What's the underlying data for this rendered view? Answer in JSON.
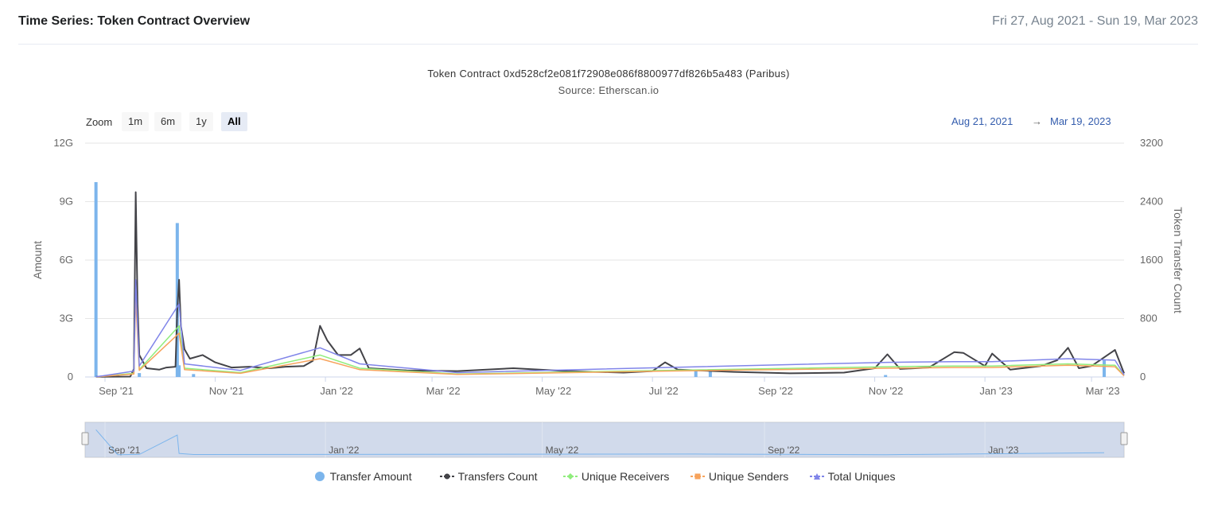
{
  "header": {
    "title": "Time Series: Token Contract Overview",
    "date_range": "Fri 27, Aug 2021 - Sun 19, Mar 2023"
  },
  "zoom": {
    "label": "Zoom",
    "buttons": [
      "1m",
      "6m",
      "1y",
      "All"
    ],
    "active": "All"
  },
  "range_selector": {
    "from": "Aug 21, 2021",
    "separator": "→",
    "to": "Mar 19, 2023"
  },
  "colors": {
    "transfer_amount": "#7cb5ec",
    "transfers_count": "#434348",
    "unique_receivers": "#90ed7d",
    "unique_senders": "#f7a35c",
    "total_uniques": "#8085e9",
    "navigator_fill": "#ccd6eb",
    "navigator_mask": "#b9c6e0"
  },
  "chart_data": {
    "type": "line",
    "title": "Token Contract 0xd528cf2e081f72908e086f8800977df826b5a483 (Paribus)",
    "subtitle": "Source: Etherscan.io",
    "xlabel": "",
    "x_ticks": [
      "Sep '21",
      "Nov '21",
      "Jan '22",
      "Mar '22",
      "May '22",
      "Jul '22",
      "Sep '22",
      "Nov '22",
      "Jan '23",
      "Mar '23"
    ],
    "navigator_ticks": [
      "Sep '21",
      "Jan '22",
      "May '22",
      "Sep '22",
      "Jan '23"
    ],
    "x_range": [
      "2021-08-21",
      "2023-03-19"
    ],
    "y_left": {
      "label": "Amount",
      "ticks": [
        "0",
        "3G",
        "6G",
        "9G",
        "12G"
      ],
      "ylim": [
        0,
        12000000000
      ]
    },
    "y_right": {
      "label": "Token Transfer Count",
      "ticks": [
        "0",
        "800",
        "1600",
        "2400",
        "3200"
      ],
      "ylim": [
        0,
        3200
      ]
    },
    "grid": true,
    "legend_position": "bottom-center",
    "series": [
      {
        "name": "Transfer Amount",
        "type": "column",
        "axis": "left",
        "points": [
          [
            "2021-08-27",
            10000000000
          ],
          [
            "2021-09-08",
            100000000
          ],
          [
            "2021-09-20",
            200000000
          ],
          [
            "2021-10-11",
            7900000000
          ],
          [
            "2021-10-12",
            600000000
          ],
          [
            "2021-10-20",
            150000000
          ],
          [
            "2022-07-25",
            350000000
          ],
          [
            "2022-08-02",
            300000000
          ],
          [
            "2022-11-07",
            100000000
          ],
          [
            "2023-03-08",
            850000000
          ]
        ]
      },
      {
        "name": "Transfers Count",
        "type": "line",
        "axis": "right",
        "points": [
          [
            "2021-08-27",
            2
          ],
          [
            "2021-09-15",
            5
          ],
          [
            "2021-09-17",
            110
          ],
          [
            "2021-09-18",
            2530
          ],
          [
            "2021-09-19",
            1000
          ],
          [
            "2021-09-20",
            300
          ],
          [
            "2021-09-24",
            120
          ],
          [
            "2021-10-01",
            100
          ],
          [
            "2021-10-05",
            130
          ],
          [
            "2021-10-10",
            140
          ],
          [
            "2021-10-11",
            900
          ],
          [
            "2021-10-12",
            1330
          ],
          [
            "2021-10-13",
            700
          ],
          [
            "2021-10-15",
            380
          ],
          [
            "2021-10-18",
            250
          ],
          [
            "2021-10-25",
            300
          ],
          [
            "2021-11-01",
            200
          ],
          [
            "2021-11-10",
            130
          ],
          [
            "2021-11-20",
            140
          ],
          [
            "2021-12-01",
            120
          ],
          [
            "2021-12-10",
            140
          ],
          [
            "2021-12-20",
            150
          ],
          [
            "2021-12-25",
            220
          ],
          [
            "2021-12-29",
            700
          ],
          [
            "2022-01-02",
            500
          ],
          [
            "2022-01-08",
            300
          ],
          [
            "2022-01-15",
            300
          ],
          [
            "2022-01-20",
            390
          ],
          [
            "2022-01-25",
            120
          ],
          [
            "2022-02-15",
            90
          ],
          [
            "2022-03-15",
            80
          ],
          [
            "2022-04-15",
            120
          ],
          [
            "2022-05-15",
            80
          ],
          [
            "2022-06-15",
            60
          ],
          [
            "2022-07-01",
            80
          ],
          [
            "2022-07-08",
            200
          ],
          [
            "2022-07-15",
            100
          ],
          [
            "2022-08-15",
            70
          ],
          [
            "2022-09-15",
            50
          ],
          [
            "2022-10-15",
            60
          ],
          [
            "2022-11-01",
            120
          ],
          [
            "2022-11-08",
            310
          ],
          [
            "2022-11-15",
            110
          ],
          [
            "2022-12-01",
            130
          ],
          [
            "2022-12-15",
            340
          ],
          [
            "2022-12-20",
            330
          ],
          [
            "2023-01-01",
            150
          ],
          [
            "2023-01-05",
            320
          ],
          [
            "2023-01-15",
            100
          ],
          [
            "2023-02-01",
            150
          ],
          [
            "2023-02-10",
            230
          ],
          [
            "2023-02-16",
            400
          ],
          [
            "2023-02-22",
            120
          ],
          [
            "2023-03-01",
            150
          ],
          [
            "2023-03-14",
            370
          ],
          [
            "2023-03-19",
            50
          ]
        ]
      },
      {
        "name": "Unique Receivers",
        "type": "line",
        "axis": "right",
        "points": [
          [
            "2021-08-27",
            1
          ],
          [
            "2021-09-17",
            50
          ],
          [
            "2021-09-18",
            1200
          ],
          [
            "2021-09-20",
            100
          ],
          [
            "2021-10-12",
            700
          ],
          [
            "2021-10-15",
            120
          ],
          [
            "2021-11-15",
            60
          ],
          [
            "2021-12-29",
            300
          ],
          [
            "2022-01-20",
            120
          ],
          [
            "2022-03-15",
            40
          ],
          [
            "2022-07-08",
            90
          ],
          [
            "2022-11-08",
            140
          ],
          [
            "2022-12-15",
            150
          ],
          [
            "2023-01-05",
            150
          ],
          [
            "2023-02-16",
            180
          ],
          [
            "2023-03-14",
            160
          ],
          [
            "2023-03-19",
            20
          ]
        ]
      },
      {
        "name": "Unique Senders",
        "type": "line",
        "axis": "right",
        "points": [
          [
            "2021-08-27",
            1
          ],
          [
            "2021-09-17",
            40
          ],
          [
            "2021-09-18",
            1100
          ],
          [
            "2021-09-20",
            90
          ],
          [
            "2021-10-12",
            600
          ],
          [
            "2021-10-15",
            100
          ],
          [
            "2021-11-15",
            50
          ],
          [
            "2021-12-29",
            250
          ],
          [
            "2022-01-20",
            100
          ],
          [
            "2022-03-15",
            35
          ],
          [
            "2022-07-08",
            80
          ],
          [
            "2022-11-08",
            120
          ],
          [
            "2022-12-15",
            130
          ],
          [
            "2023-01-05",
            130
          ],
          [
            "2023-02-16",
            160
          ],
          [
            "2023-03-14",
            140
          ],
          [
            "2023-03-19",
            15
          ]
        ]
      },
      {
        "name": "Total Uniques",
        "type": "line",
        "axis": "right",
        "points": [
          [
            "2021-08-27",
            2
          ],
          [
            "2021-09-17",
            80
          ],
          [
            "2021-09-18",
            1330
          ],
          [
            "2021-09-20",
            150
          ],
          [
            "2021-10-12",
            1000
          ],
          [
            "2021-10-15",
            180
          ],
          [
            "2021-11-15",
            90
          ],
          [
            "2021-12-29",
            400
          ],
          [
            "2022-01-20",
            180
          ],
          [
            "2022-03-15",
            60
          ],
          [
            "2022-07-08",
            130
          ],
          [
            "2022-11-08",
            200
          ],
          [
            "2022-12-15",
            210
          ],
          [
            "2023-01-05",
            210
          ],
          [
            "2023-02-16",
            250
          ],
          [
            "2023-03-14",
            230
          ],
          [
            "2023-03-19",
            30
          ]
        ]
      }
    ]
  }
}
